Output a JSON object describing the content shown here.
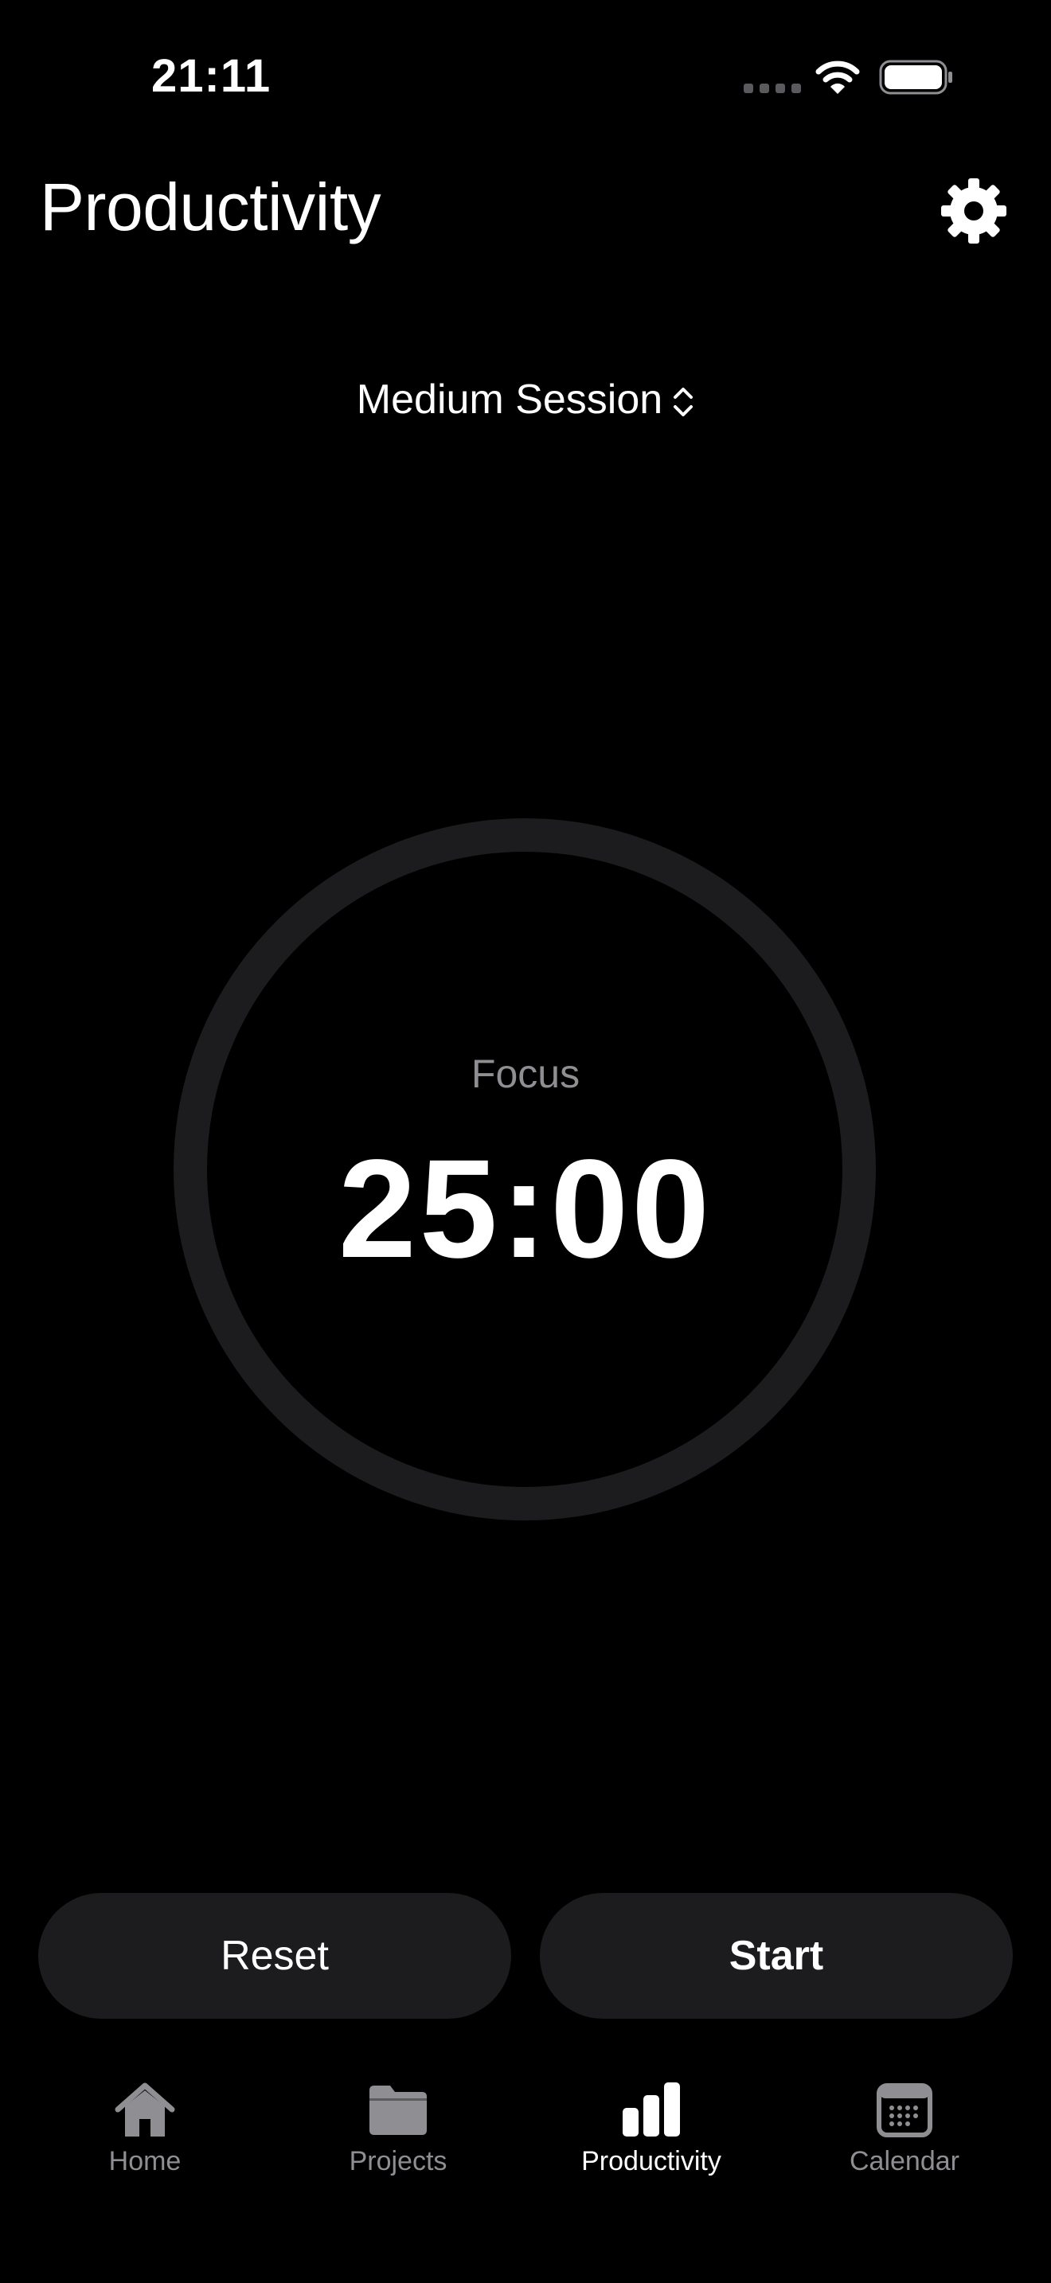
{
  "status_bar": {
    "time": "21:11"
  },
  "header": {
    "title": "Productivity"
  },
  "session": {
    "label": "Medium Session"
  },
  "timer": {
    "phase": "Focus",
    "value": "25:00",
    "progress": 0
  },
  "actions": {
    "reset_label": "Reset",
    "start_label": "Start"
  },
  "tabs": [
    {
      "label": "Home",
      "icon": "house-icon",
      "active": false
    },
    {
      "label": "Projects",
      "icon": "folder-icon",
      "active": false
    },
    {
      "label": "Productivity",
      "icon": "bar-chart-icon",
      "active": true
    },
    {
      "label": "Calendar",
      "icon": "calendar-icon",
      "active": false
    }
  ],
  "colors": {
    "background": "#000000",
    "surface": "#1c1c1e",
    "ring_track": "#1c1c1e",
    "inactive": "#8e8e93",
    "active": "#ffffff"
  }
}
